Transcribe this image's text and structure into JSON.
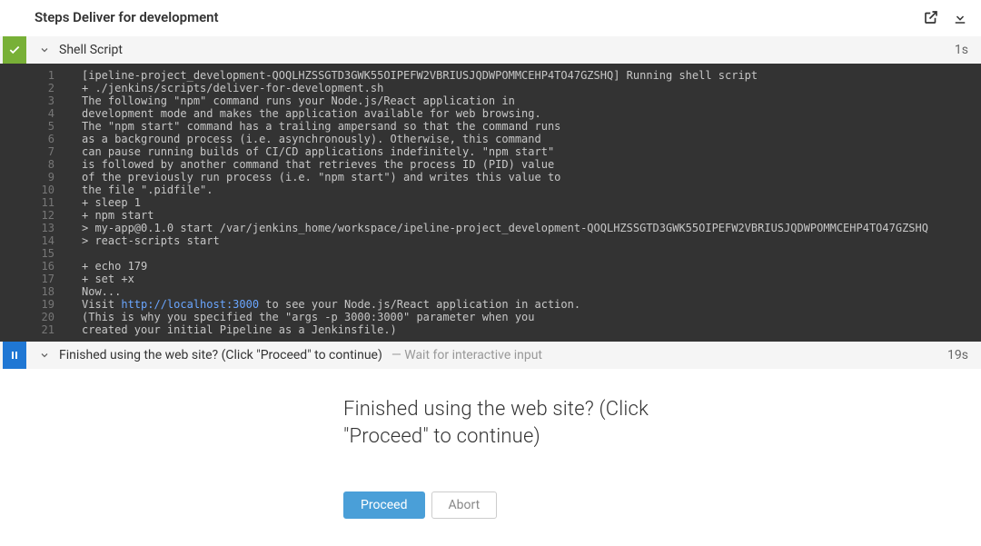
{
  "header": {
    "title": "Steps Deliver for development"
  },
  "step1": {
    "name": "Shell Script",
    "duration": "1s"
  },
  "console": {
    "link_url": "http://localhost:3000",
    "lines": [
      "[ipeline-project_development-QOQLHZSSGTD3GWK55OIPEFW2VBRIUSJQDWPOMMCEHP4TO47GZSHQ] Running shell script",
      "+ ./jenkins/scripts/deliver-for-development.sh",
      "The following \"npm\" command runs your Node.js/React application in",
      "development mode and makes the application available for web browsing.",
      "The \"npm start\" command has a trailing ampersand so that the command runs",
      "as a background process (i.e. asynchronously). Otherwise, this command",
      "can pause running builds of CI/CD applications indefinitely. \"npm start\"",
      "is followed by another command that retrieves the process ID (PID) value",
      "of the previously run process (i.e. \"npm start\") and writes this value to",
      "the file \".pidfile\".",
      "+ sleep 1",
      "+ npm start",
      "> my-app@0.1.0 start /var/jenkins_home/workspace/ipeline-project_development-QOQLHZSSGTD3GWK55OIPEFW2VBRIUSJQDWPOMMCEHP4TO47GZSHQ",
      "> react-scripts start",
      "",
      "+ echo 179",
      "+ set +x",
      "Now...",
      "Visit http://localhost:3000 to see your Node.js/React application in action.",
      "(This is why you specified the \"args -p 3000:3000\" parameter when you",
      "created your initial Pipeline as a Jenkinsfile.)"
    ]
  },
  "step2": {
    "name": "Finished using the web site? (Click \"Proceed\" to continue)",
    "subtitle": "— Wait for interactive input",
    "duration": "19s"
  },
  "prompt": {
    "text": "Finished using the web site? (Click \"Proceed\" to continue)",
    "proceed": "Proceed",
    "abort": "Abort"
  }
}
